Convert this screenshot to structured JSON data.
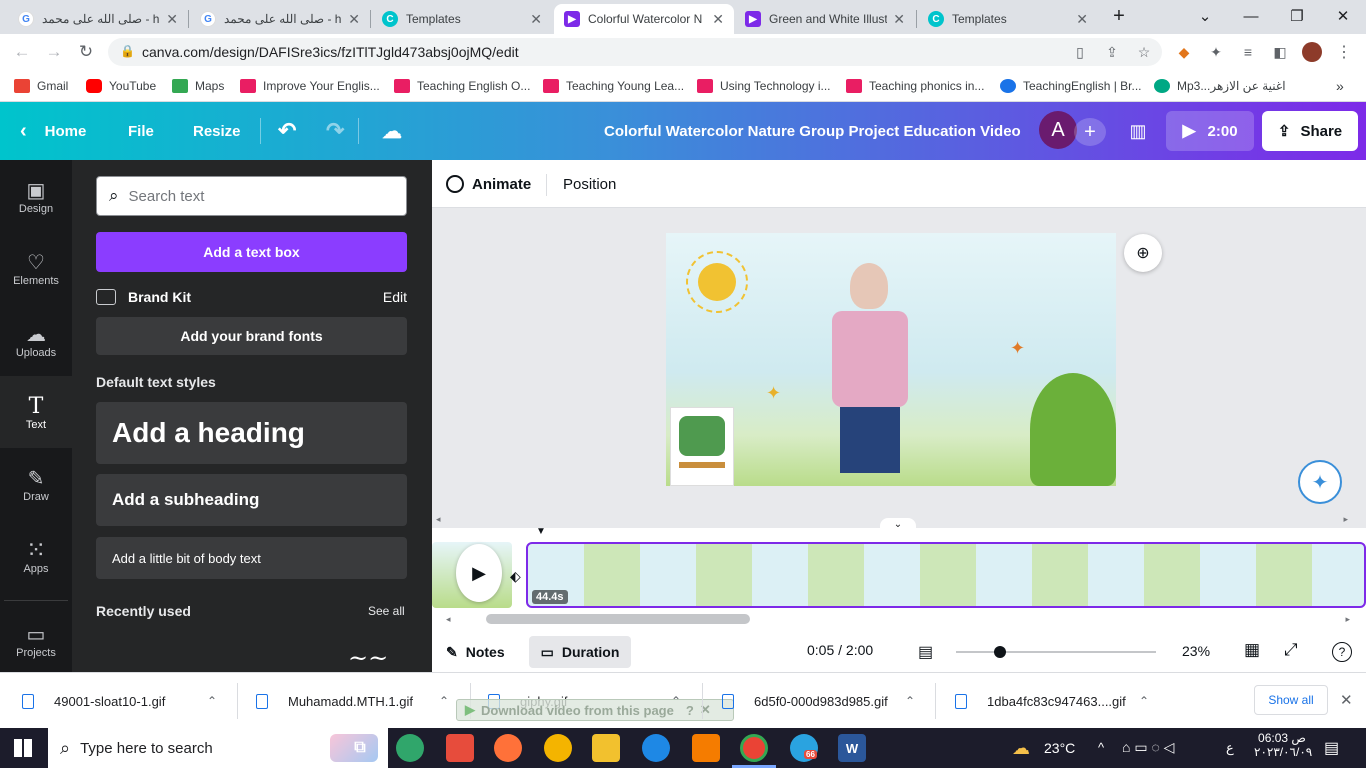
{
  "browser": {
    "tabs": [
      {
        "title": "صلى الله على محمد - h",
        "icon": "G"
      },
      {
        "title": "صلى الله على محمد - h",
        "icon": "G"
      },
      {
        "title": "Templates",
        "icon": "C"
      },
      {
        "title": "Colorful Watercolor N",
        "icon": "▶"
      },
      {
        "title": "Green and White Illust",
        "icon": "▶"
      },
      {
        "title": "Templates",
        "icon": "C"
      }
    ],
    "url": "canva.com/design/DAFISre3ics/fzITlTJgld473absj0ojMQ/edit",
    "bookmarks": [
      {
        "label": "Gmail",
        "color": "#ea4335"
      },
      {
        "label": "YouTube",
        "color": "#ff0000"
      },
      {
        "label": "Maps",
        "color": "#34a853"
      },
      {
        "label": "Improve Your Englis...",
        "color": "#e91e63"
      },
      {
        "label": "Teaching English O...",
        "color": "#e91e63"
      },
      {
        "label": "Teaching Young Lea...",
        "color": "#e91e63"
      },
      {
        "label": "Using Technology i...",
        "color": "#e91e63"
      },
      {
        "label": "Teaching phonics in...",
        "color": "#e91e63"
      },
      {
        "label": "TeachingEnglish | Br...",
        "color": "#1a73e8"
      },
      {
        "label": "Mp3...اغنية عن الازهر",
        "color": "#00a884"
      }
    ]
  },
  "header": {
    "home": "Home",
    "file": "File",
    "resize": "Resize",
    "title": "Colorful  Watercolor Nature  Group Project Education Video",
    "avatar": "A",
    "play_time": "2:00",
    "share": "Share"
  },
  "rail": [
    {
      "label": "Design",
      "icon": "design-icon",
      "glyph": "▣"
    },
    {
      "label": "Elements",
      "icon": "elements-icon",
      "glyph": "♡"
    },
    {
      "label": "Uploads",
      "icon": "uploads-icon",
      "glyph": "☁"
    },
    {
      "label": "Text",
      "icon": "text-icon",
      "glyph": "T"
    },
    {
      "label": "Draw",
      "icon": "draw-icon",
      "glyph": "✎"
    },
    {
      "label": "Apps",
      "icon": "apps-icon",
      "glyph": "⁙"
    },
    {
      "label": "Projects",
      "icon": "projects-icon",
      "glyph": "▭"
    }
  ],
  "panel": {
    "search_placeholder": "Search text",
    "add_text_box": "Add a text box",
    "brand_kit": "Brand Kit",
    "brand_edit": "Edit",
    "add_brand_fonts": "Add your brand fonts",
    "default_styles": "Default text styles",
    "heading": "Add a heading",
    "subheading": "Add a subheading",
    "body": "Add a little bit of body text",
    "recently_used": "Recently used",
    "see_all": "See all"
  },
  "context": {
    "animate": "Animate",
    "position": "Position"
  },
  "timeline": {
    "playhead": "44.4s"
  },
  "bottom": {
    "notes": "Notes",
    "duration": "Duration",
    "time": "0:05 / 2:00",
    "zoom": "23%",
    "zoom_level": 0.22
  },
  "downloads": [
    {
      "name": "49001-sloat10-1.gif"
    },
    {
      "name": "Muhamadd.MTH.1.gif"
    },
    {
      "name": "giphy.gif"
    },
    {
      "name": "6d5f0-000d983d985.gif"
    },
    {
      "name": "1dba4fc83c947463....gif"
    }
  ],
  "download_overlay": "Download video from this page",
  "show_all": "Show all",
  "taskbar": {
    "search": "Type here to search",
    "temp": "23°C",
    "time": "06:03",
    "ampm": "ص",
    "date": "٢٠٢٣/٠٦/٠٩",
    "lang": "ع",
    "telegram_badge": "66"
  },
  "colors": {
    "purple": "#8b3dff",
    "teal": "#00c4cc",
    "dark": "#252627"
  }
}
